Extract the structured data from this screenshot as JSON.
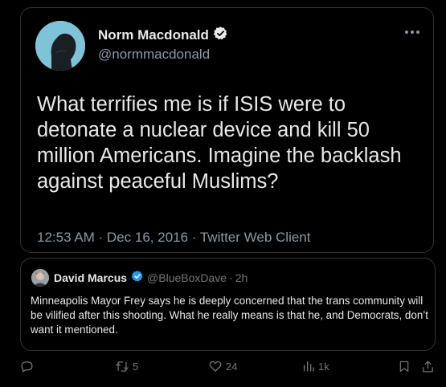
{
  "quoted_tweet": {
    "author_name": "Norm Macdonald",
    "author_handle": "@normmacdonald",
    "text": "What terrifies me is if ISIS were to detonate a nuclear device and kill 50 million Americans. Imagine the backlash against peaceful Muslims?",
    "meta": "12:53 AM · Dec 16, 2016 · Twitter Web Client",
    "more_icon": "more-dots-icon"
  },
  "main_tweet": {
    "author_name": "David Marcus",
    "author_handle": "@BlueBoxDave",
    "time": "2h",
    "text": "Minneapolis Mayor Frey says he is deeply concerned that the trans community will be vilified after this shooting. What he really means is that he, and Democrats, don’t want it mentioned."
  },
  "actions": {
    "reply_count": "",
    "retweet_count": "5",
    "like_count": "24",
    "views_count": "1k"
  },
  "colors": {
    "background": "#000000",
    "text": "#e7e9ea",
    "muted": "#71767b",
    "verified": "#1d9bf0",
    "border": "#2f3336"
  }
}
